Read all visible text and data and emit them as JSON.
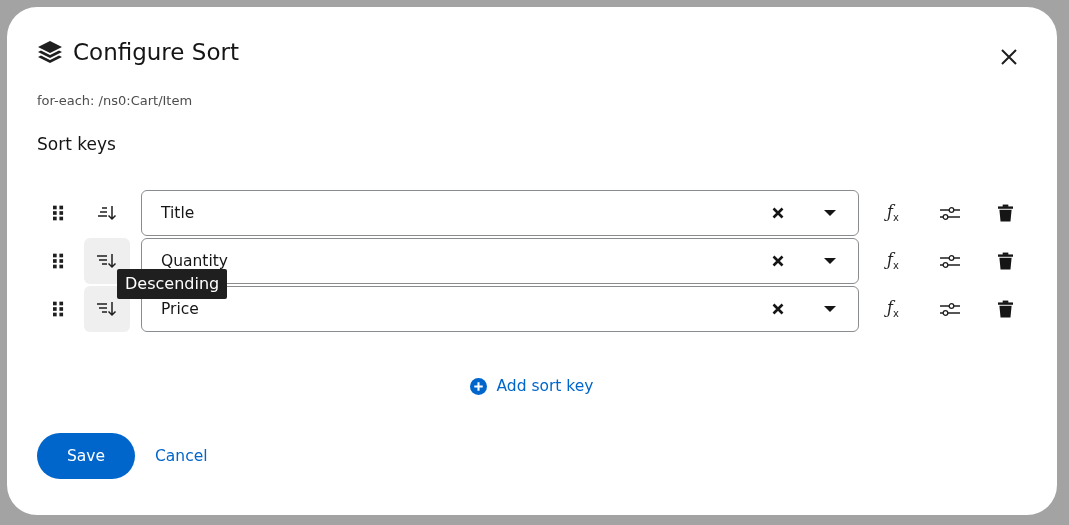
{
  "dialog": {
    "title": "Configure Sort",
    "subtitle": "for-each: /ns0:Cart/Item",
    "section_title": "Sort keys"
  },
  "sort_keys": [
    {
      "field": "Title",
      "kind": "ascending",
      "function_label": "ƒ$_{x}$"
    },
    {
      "field": "Quantity",
      "kind": "descending",
      "function_label": "ƒ$_{x}$"
    },
    {
      "field": "Price",
      "kind": "descending",
      "function_label": "ƒ$_{x}$"
    }
  ],
  "tooltip": {
    "text": "Descending"
  },
  "add_button": "Add sort key",
  "buttons": {
    "primary": "Save",
    "secondary": "Cancel"
  }
}
